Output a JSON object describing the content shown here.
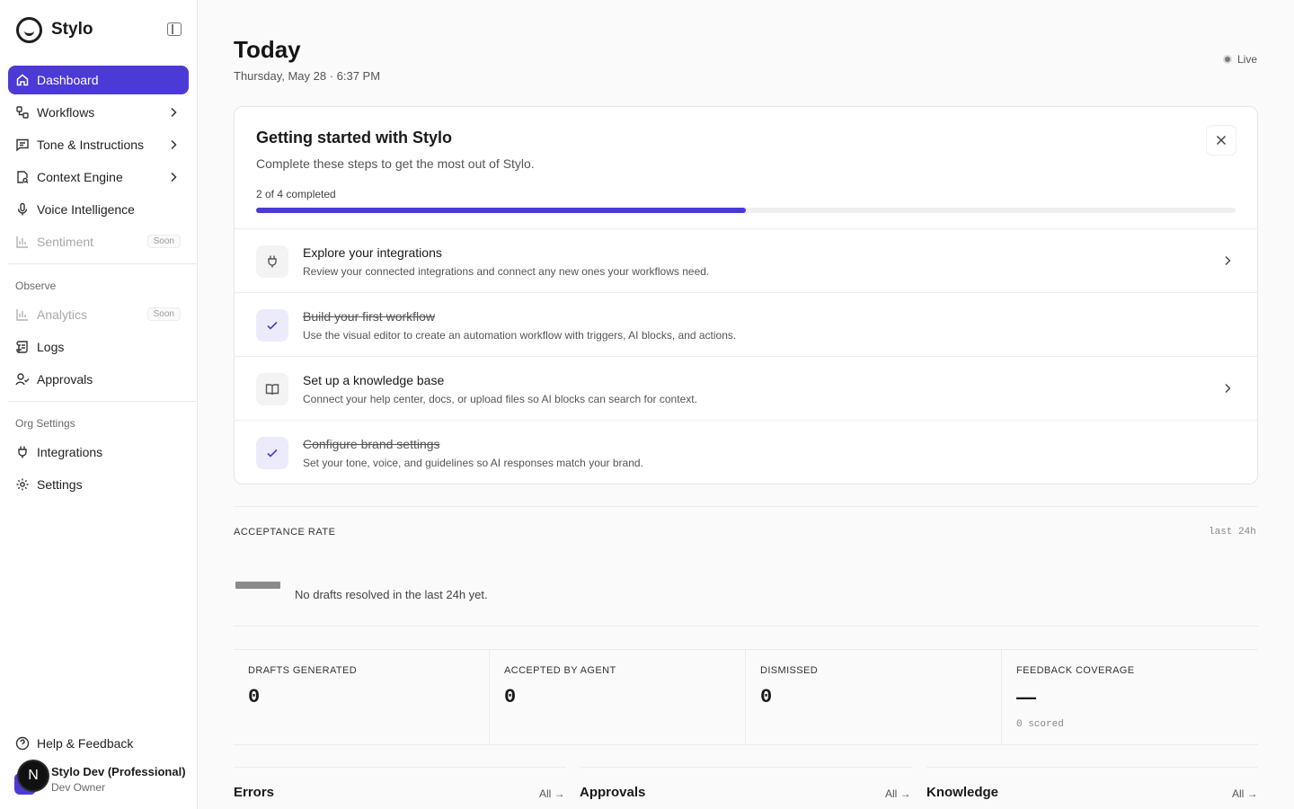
{
  "brand": {
    "name": "Stylo"
  },
  "sidebar": {
    "items": [
      {
        "label": "Dashboard",
        "icon": "home-icon",
        "active": true
      },
      {
        "label": "Workflows",
        "icon": "workflow-icon",
        "chevron": true
      },
      {
        "label": "Tone & Instructions",
        "icon": "message-icon",
        "chevron": true
      },
      {
        "label": "Context Engine",
        "icon": "search-doc-icon",
        "chevron": true
      },
      {
        "label": "Voice Intelligence",
        "icon": "mic-icon"
      },
      {
        "label": "Sentiment",
        "icon": "bar-chart-icon",
        "badge": "Soon",
        "disabled": true
      }
    ],
    "observe_label": "Observe",
    "observe_items": [
      {
        "label": "Analytics",
        "icon": "bar-chart-icon",
        "badge": "Soon",
        "disabled": true
      },
      {
        "label": "Logs",
        "icon": "scroll-icon"
      },
      {
        "label": "Approvals",
        "icon": "user-check-icon"
      }
    ],
    "org_label": "Org Settings",
    "org_items": [
      {
        "label": "Integrations",
        "icon": "plug-icon"
      },
      {
        "label": "Settings",
        "icon": "gear-icon"
      }
    ],
    "help_label": "Help & Feedback",
    "user": {
      "initial": "N",
      "name": "Stylo Dev (Professional)",
      "role": "Dev Owner"
    }
  },
  "header": {
    "title": "Today",
    "date": "Thursday, May 28 · 6:37 PM",
    "live_label": "Live"
  },
  "onboarding": {
    "title": "Getting started with Stylo",
    "subtitle": "Complete these steps to get the most out of Stylo.",
    "progress_label": "2 of 4 completed",
    "progress_fraction": 0.5,
    "steps": [
      {
        "title": "Explore your integrations",
        "desc": "Review your connected integrations and connect any new ones your workflows need.",
        "done": false,
        "icon": "plug-icon"
      },
      {
        "title": "Build your first workflow",
        "desc": "Use the visual editor to create an automation workflow with triggers, AI blocks, and actions.",
        "done": true,
        "icon": "check-icon"
      },
      {
        "title": "Set up a knowledge base",
        "desc": "Connect your help center, docs, or upload files so AI blocks can search for context.",
        "done": false,
        "icon": "book-icon"
      },
      {
        "title": "Configure brand settings",
        "desc": "Set your tone, voice, and guidelines so AI responses match your brand.",
        "done": true,
        "icon": "check-icon"
      }
    ]
  },
  "acceptance": {
    "heading": "ACCEPTANCE RATE",
    "range": "last 24h",
    "empty_text": "No drafts resolved in the last 24h yet."
  },
  "stats": [
    {
      "label": "DRAFTS GENERATED",
      "value": "0",
      "note": ""
    },
    {
      "label": "ACCEPTED BY AGENT",
      "value": "0",
      "note": ""
    },
    {
      "label": "DISMISSED",
      "value": "0",
      "note": ""
    },
    {
      "label": "FEEDBACK COVERAGE",
      "value": "—",
      "note": "0 scored"
    }
  ],
  "panels": [
    {
      "title": "Errors",
      "link": "All →"
    },
    {
      "title": "Approvals",
      "link": "All →"
    },
    {
      "title": "Knowledge",
      "link": "All →"
    }
  ],
  "colors": {
    "accent": "#4b3ad6"
  }
}
